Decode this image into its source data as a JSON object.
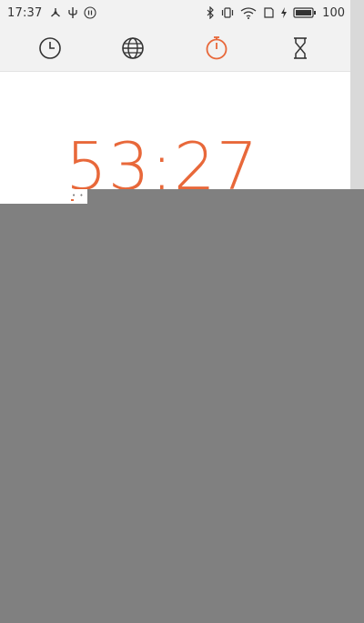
{
  "status_bar": {
    "time": "17:37",
    "battery": "100",
    "icons_left": [
      "share-icon",
      "usb-icon",
      "pause-circle-icon"
    ],
    "icons_right": [
      "bluetooth-icon",
      "vibrate-icon",
      "wifi-icon",
      "sim-icon",
      "charging-icon",
      "battery-icon"
    ]
  },
  "tabs": [
    {
      "name": "clock",
      "icon": "clock-icon",
      "active": false
    },
    {
      "name": "world-clock",
      "icon": "globe-icon",
      "active": false
    },
    {
      "name": "stopwatch",
      "icon": "stopwatch-icon",
      "active": true
    },
    {
      "name": "timer",
      "icon": "hourglass-icon",
      "active": false
    }
  ],
  "stopwatch": {
    "display": "53:27",
    "small_marks": "• •"
  },
  "colors": {
    "accent": "#e8683a",
    "icon": "#333333",
    "overlay": "#808080",
    "bar": "#f2f2f2"
  }
}
